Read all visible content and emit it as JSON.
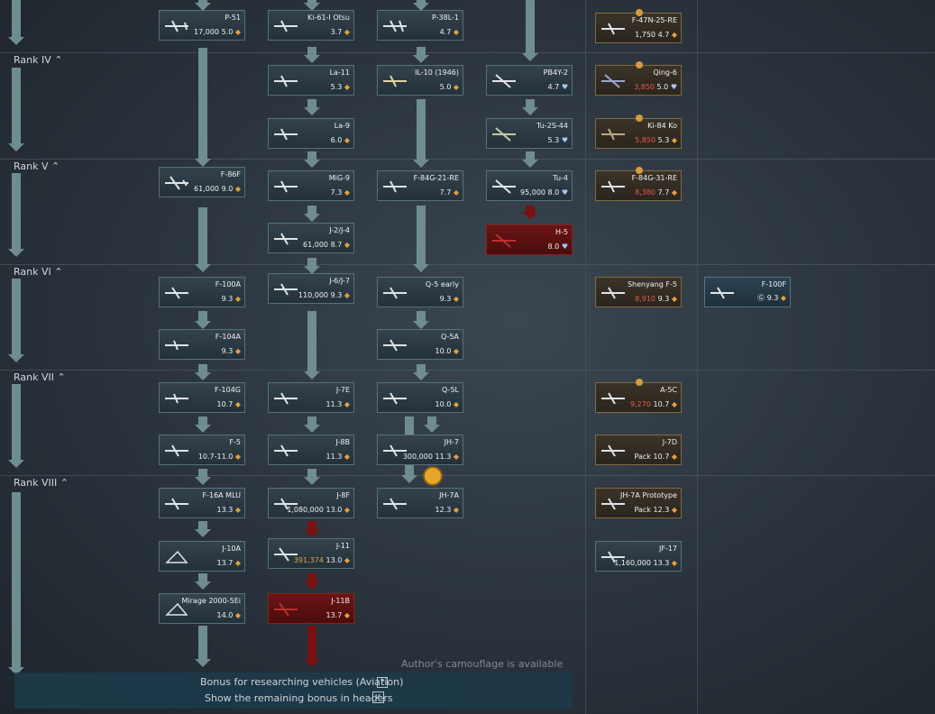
{
  "ranks": [
    {
      "label": "Rank IV"
    },
    {
      "label": "Rank V"
    },
    {
      "label": "Rank VI"
    },
    {
      "label": "Rank VII"
    },
    {
      "label": "Rank VIII"
    }
  ],
  "cards": {
    "p51": {
      "name": "P-51",
      "cost": "17,000",
      "br": "5.0"
    },
    "ki61": {
      "name": "Ki-61-I Otsu",
      "br": "3.7"
    },
    "p38": {
      "name": "P-38L-1",
      "br": "4.7"
    },
    "f47": {
      "name": "F-47N-25-RE",
      "cost": "1,750",
      "br": "4.7"
    },
    "la11": {
      "name": "La-11",
      "br": "5.3"
    },
    "il10": {
      "name": "IL-10 (1946)",
      "br": "5.0"
    },
    "pb4y": {
      "name": "PB4Y-2",
      "br": "4.7"
    },
    "qing6": {
      "name": "Qing-6",
      "cost": "3,850",
      "br": "5.0"
    },
    "la9": {
      "name": "La-9",
      "br": "6.0"
    },
    "tu2s": {
      "name": "Tu-2S-44",
      "br": "5.3"
    },
    "ki84": {
      "name": "Ki-84 Ko",
      "cost": "5,850",
      "br": "5.3"
    },
    "f86f": {
      "name": "F-86F",
      "cost": "61,000",
      "br": "9.0"
    },
    "mig9": {
      "name": "MiG-9",
      "br": "7.3"
    },
    "f84g": {
      "name": "F-84G-21-RE",
      "br": "7.7"
    },
    "tu4": {
      "name": "Tu-4",
      "cost": "95,000",
      "br": "8.0"
    },
    "f84g31": {
      "name": "F-84G-31-RE",
      "cost": "8,380",
      "br": "7.7"
    },
    "j2": {
      "name": "J-2/J-4",
      "cost": "61,000",
      "br": "8.7"
    },
    "h5": {
      "name": "H-5",
      "br": "8.0"
    },
    "f100a": {
      "name": "F-100A",
      "br": "9.3"
    },
    "j6": {
      "name": "J-6/J-7",
      "cost": "110,000",
      "br": "9.3"
    },
    "q5e": {
      "name": "Q-5 early",
      "br": "9.3"
    },
    "shenyang": {
      "name": "Shenyang F-5",
      "cost": "8,910",
      "br": "9.3"
    },
    "f100f": {
      "name": "F-100F",
      "br": "9.3"
    },
    "f104a": {
      "name": "F-104A",
      "br": "9.3"
    },
    "q5a": {
      "name": "Q-5A",
      "br": "10.0"
    },
    "f104g": {
      "name": "F-104G",
      "br": "10.7"
    },
    "j7e": {
      "name": "J-7E",
      "br": "11.3"
    },
    "q5l": {
      "name": "Q-5L",
      "br": "10.0"
    },
    "a5c": {
      "name": "A-5C",
      "cost": "9,270",
      "br": "10.7"
    },
    "f5": {
      "name": "F-5",
      "br": "10.7-11.0"
    },
    "j8b": {
      "name": "J-8B",
      "br": "11.3"
    },
    "jh7": {
      "name": "JH-7",
      "cost": "300,000",
      "br": "11.3"
    },
    "j7d": {
      "name": "J-7D",
      "cost": "Pack",
      "br": "10.7"
    },
    "f16": {
      "name": "F-16A MLU",
      "br": "13.3"
    },
    "j8f": {
      "name": "J-8F",
      "cost": "1,080,000",
      "br": "13.0"
    },
    "jh7a": {
      "name": "JH-7A",
      "br": "12.3"
    },
    "jh7ap": {
      "name": "JH-7A Prototype",
      "cost": "Pack",
      "br": "12.3"
    },
    "j10a": {
      "name": "J-10A",
      "br": "13.7"
    },
    "j11": {
      "name": "J-11",
      "cost": "391,374",
      "br": "13.0"
    },
    "jf17": {
      "name": "JF-17",
      "cost": "1,160,000",
      "br": "13.3"
    },
    "mirage": {
      "name": "Mirage 2000-5Ei",
      "br": "14.0"
    },
    "j11b": {
      "name": "J-11B",
      "br": "13.7"
    }
  },
  "footer": {
    "bonus_label": "Bonus for researching vehicles (Aviation)",
    "help_glyph": "?",
    "show_label": "Show the remaining bonus in headers",
    "checked_glyph": "✓"
  },
  "ghost_text": "Author's camouflage is available",
  "colors": {
    "premium_border": "#806a42",
    "researched_red": "#6b1515",
    "arrow": "#6f8d91"
  }
}
